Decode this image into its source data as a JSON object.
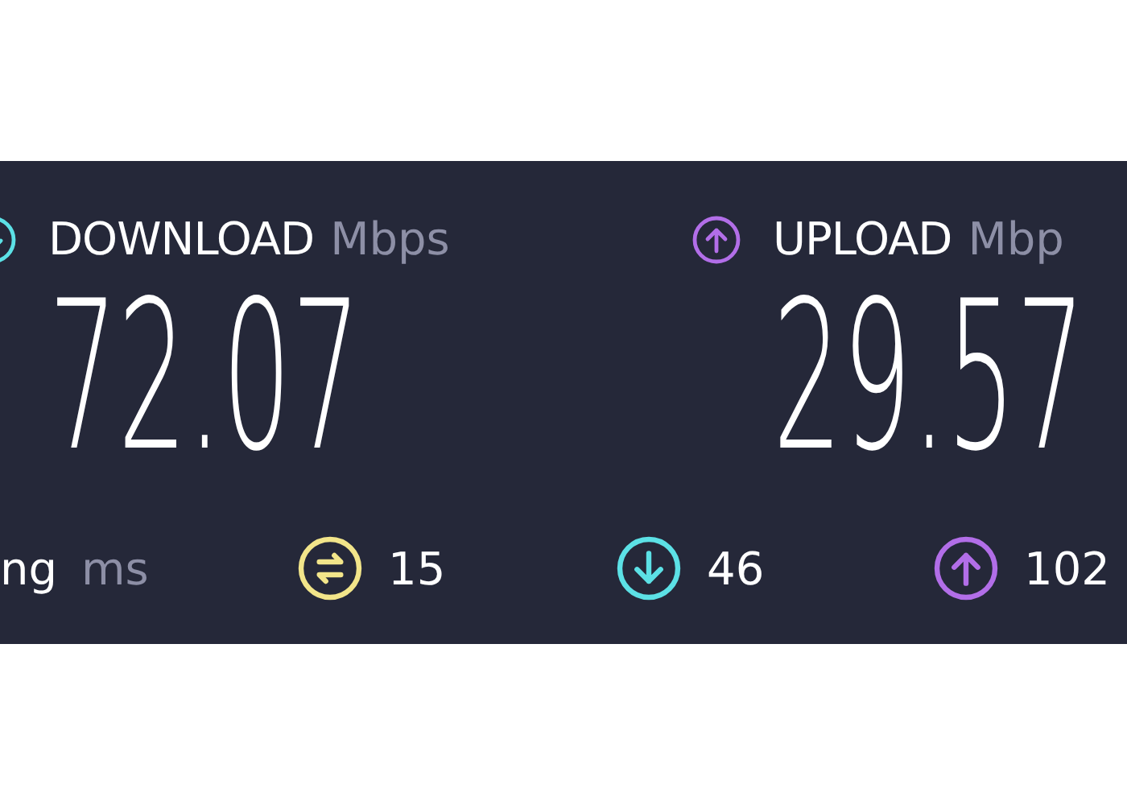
{
  "primary": [
    {
      "kind": "download",
      "label": "DOWNLOAD",
      "unit": "Mbps",
      "value": "72.07",
      "color": "#5ce1e6"
    },
    {
      "kind": "upload",
      "label": "UPLOAD",
      "unit": "Mbp",
      "value": "29.57",
      "color": "#b26ee8"
    }
  ],
  "latency": {
    "label": "ng",
    "unit": "ms",
    "items": [
      {
        "kind": "idle",
        "value": "15",
        "color": "#f2e58a"
      },
      {
        "kind": "download",
        "value": "46",
        "color": "#5ce1e6"
      },
      {
        "kind": "upload",
        "value": "102",
        "color": "#b26ee8"
      }
    ]
  }
}
